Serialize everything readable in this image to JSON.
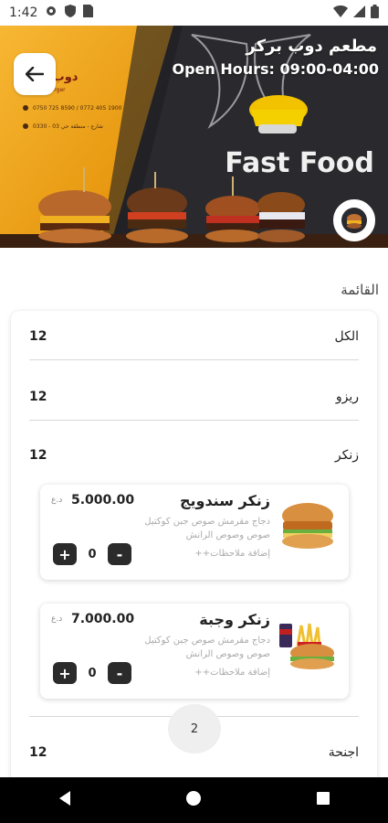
{
  "status_bar": {
    "time": "1:42"
  },
  "header": {
    "store_name": "مطعم دوب بركر",
    "open_hours": "Open Hours: 09:00-04:00",
    "banner_text": "Fast Food",
    "logo_text": "دوب بركر",
    "logo_subtext": "dub burger",
    "phone_text": "0750 725 8590 / 0772 405 1900",
    "address_text": "0330 - 03 شارع - منطقة حي"
  },
  "menu": {
    "title": "القائمة",
    "categories": [
      {
        "name": "الكل",
        "count": "12"
      },
      {
        "name": "ريزو",
        "count": "12"
      },
      {
        "name": "زنكر",
        "count": "12"
      },
      {
        "name": "اجنحة",
        "count": "12"
      }
    ],
    "items": [
      {
        "name": "زنكر سندويج",
        "price": "5.000.00",
        "currency": "د.ع",
        "description": "دجاج مقرمش صوص جبن كوكتيل صوص وصوص الرانش",
        "notes_label": "إضافة ملاحظات++",
        "quantity": "0"
      },
      {
        "name": "زنكر وجبة",
        "price": "7.000.00",
        "currency": "د.ع",
        "description": "دجاج مقرمش صوص جبن كوكتيل صوص وصوص الرانش",
        "notes_label": "إضافة ملاحظات++",
        "quantity": "0"
      }
    ],
    "minus_label": "-",
    "plus_label": "+",
    "page_indicator": "2"
  },
  "colors": {
    "banner_yellow": "#f2a51a",
    "banner_dark": "#2a2a2e",
    "button_dark": "#2b2b2b"
  }
}
